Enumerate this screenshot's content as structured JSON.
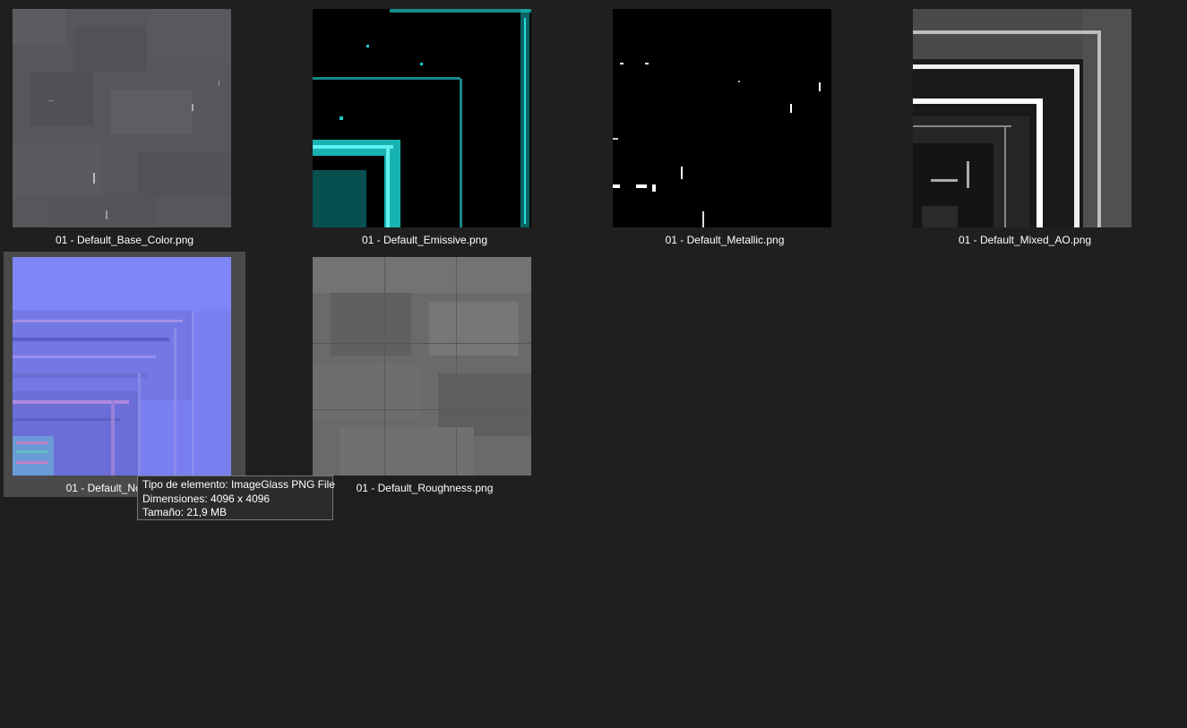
{
  "files": [
    {
      "name": "01 - Default_Base_Color.png",
      "thumbnail": "gray-stone-texture-thumbnail"
    },
    {
      "name": "01 - Default_Emissive.png",
      "thumbnail": "cyan-emissive-map-thumbnail"
    },
    {
      "name": "01 - Default_Metallic.png",
      "thumbnail": "black-metallic-map-thumbnail"
    },
    {
      "name": "01 - Default_Mixed_AO.png",
      "thumbnail": "grayscale-ao-map-thumbnail"
    },
    {
      "name": "01 - Default_Normal.png",
      "thumbnail": "purple-normal-map-thumbnail"
    },
    {
      "name": "01 - Default_Roughness.png",
      "thumbnail": "gray-roughness-map-thumbnail"
    }
  ],
  "tooltip": {
    "type_line": "Tipo de elemento: ImageGlass PNG File",
    "dimensions_line": "Dimensiones: 4096 x 4096",
    "size_line": "Tamaño: 21,9 MB"
  },
  "colors": {
    "background": "#1f1f1f",
    "selection": "#4a4a4a",
    "tooltip_bg": "#2b2b2b",
    "tooltip_border": "#767676"
  }
}
